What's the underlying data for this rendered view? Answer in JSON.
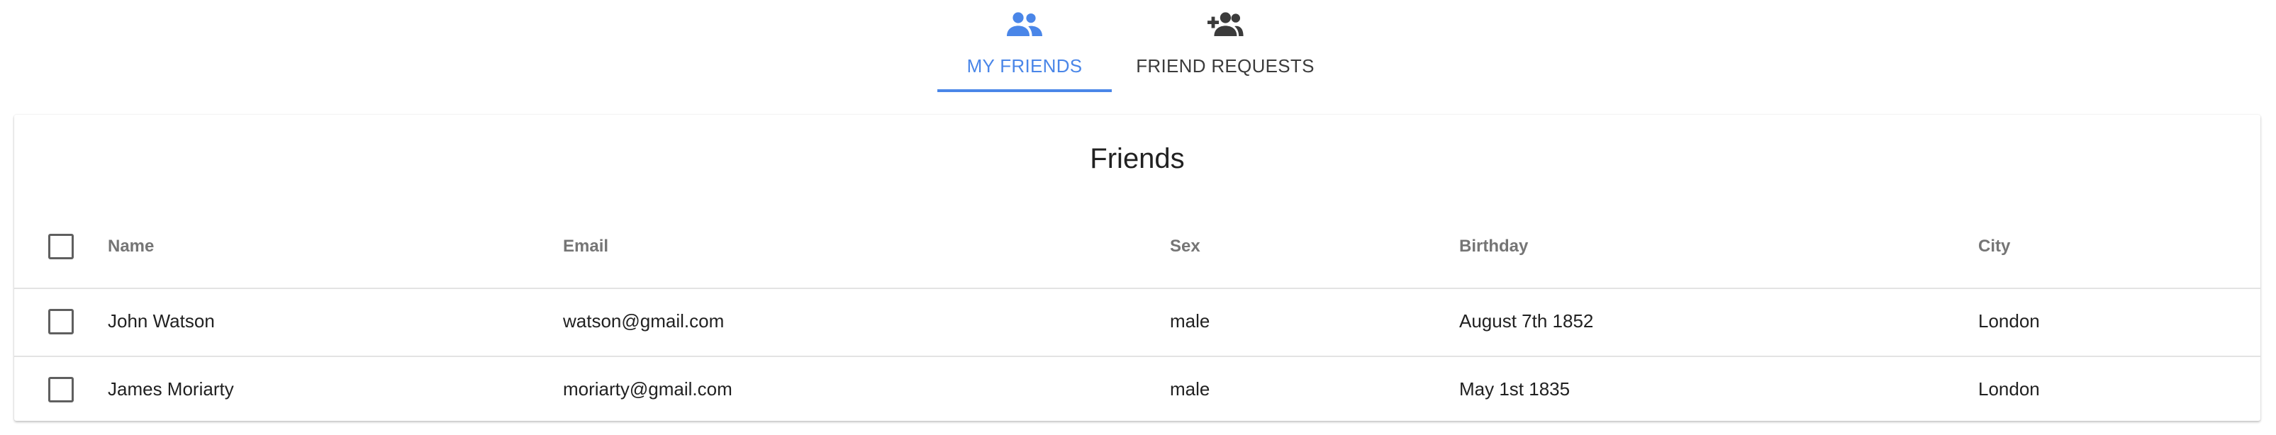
{
  "tabs": [
    {
      "label": "MY FRIENDS",
      "icon": "group-icon",
      "active": true
    },
    {
      "label": "FRIEND REQUESTS",
      "icon": "add-friend-icon",
      "active": false
    }
  ],
  "colors": {
    "accent": "#4a86e8",
    "text": "#212121",
    "header_text": "#757575"
  },
  "card": {
    "title": "Friends"
  },
  "table": {
    "columns": [
      "Name",
      "Email",
      "Sex",
      "Birthday",
      "City"
    ],
    "rows": [
      {
        "name": "John Watson",
        "email": "watson@gmail.com",
        "sex": "male",
        "birthday": "August 7th 1852",
        "city": "London",
        "selected": false
      },
      {
        "name": "James Moriarty",
        "email": "moriarty@gmail.com",
        "sex": "male",
        "birthday": "May 1st 1835",
        "city": "London",
        "selected": false
      }
    ]
  }
}
